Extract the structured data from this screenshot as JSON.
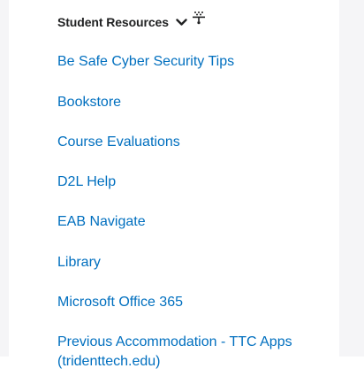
{
  "widget": {
    "title": "Student Resources",
    "icons": {
      "collapse": "chevron-down-icon",
      "drag": "drag-handle-icon"
    },
    "links": [
      "Be Safe Cyber Security Tips",
      "Bookstore",
      "Course Evaluations",
      "D2L Help",
      "EAB Navigate",
      "Library",
      "Microsoft Office 365",
      "Previous Accommodation - TTC Apps (tridenttech.edu)"
    ],
    "colors": {
      "link": "#006fbf",
      "title": "#202122",
      "page_background": "#f5f5f7"
    }
  }
}
